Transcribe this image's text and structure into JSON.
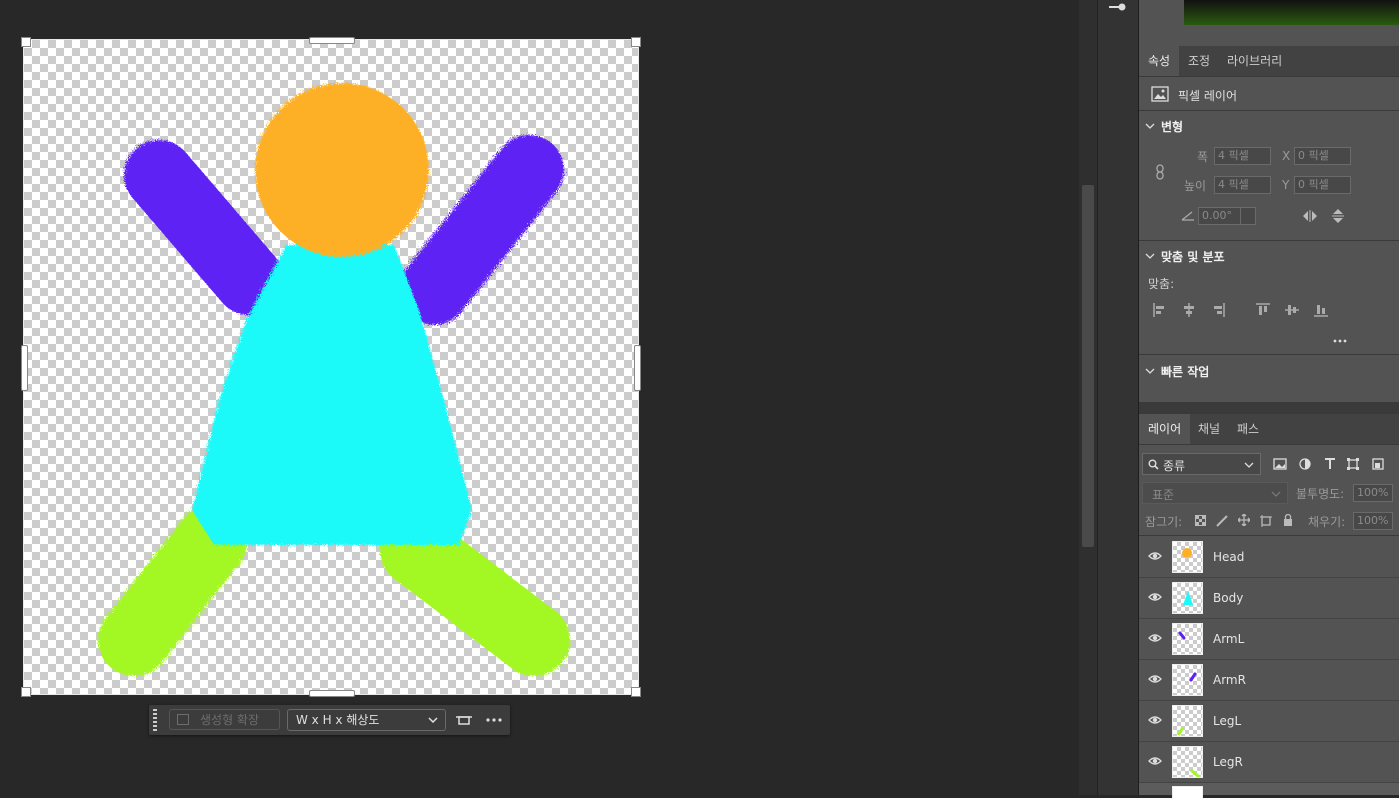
{
  "canvas": {
    "figure_colors": {
      "head": "#FDB025",
      "body": "#1BF9F9",
      "arms": "#5F20F5",
      "legs": "#A3F723"
    }
  },
  "taskbar": {
    "generative_expand_label": "생성형 확장",
    "size_select_value": "W x H x 해상도",
    "more_icon": "more-icon"
  },
  "properties_tabs": {
    "properties": "속성",
    "adjustments": "조정",
    "libraries": "라이브러리"
  },
  "properties": {
    "layer_type": "픽셀 레이어",
    "transform_title": "변형",
    "width_label": "폭",
    "height_label": "높이",
    "width_value": "4 픽셀",
    "height_value": "4 픽셀",
    "x_label": "X",
    "y_label": "Y",
    "x_value": "0 픽셀",
    "y_value": "0 픽셀",
    "angle_value": "0.00°",
    "align_title": "맞춤 및 분포",
    "align_label": "맞춤:",
    "quick_actions_title": "빠른 작업"
  },
  "layers_tabs": {
    "layers": "레이어",
    "channels": "채널",
    "paths": "패스"
  },
  "layers_panel": {
    "filter_value": "종류",
    "blend_mode": "표준",
    "opacity_label": "불투명도:",
    "opacity_value": "100%",
    "lock_label": "잠그기:",
    "fill_label": "채우기:",
    "fill_value": "100%"
  },
  "layers": [
    {
      "name": "Head",
      "thumb_color": "#FDB025",
      "thumb_shape": "dot"
    },
    {
      "name": "Body",
      "thumb_color": "#1BF9F9",
      "thumb_shape": "triangle"
    },
    {
      "name": "ArmL",
      "thumb_color": "#5F20F5",
      "thumb_shape": "stroke-left"
    },
    {
      "name": "ArmR",
      "thumb_color": "#5F20F5",
      "thumb_shape": "stroke-right"
    },
    {
      "name": "LegL",
      "thumb_color": "#A3F723",
      "thumb_shape": "stroke-bl"
    },
    {
      "name": "LegR",
      "thumb_color": "#A3F723",
      "thumb_shape": "stroke-br"
    }
  ]
}
